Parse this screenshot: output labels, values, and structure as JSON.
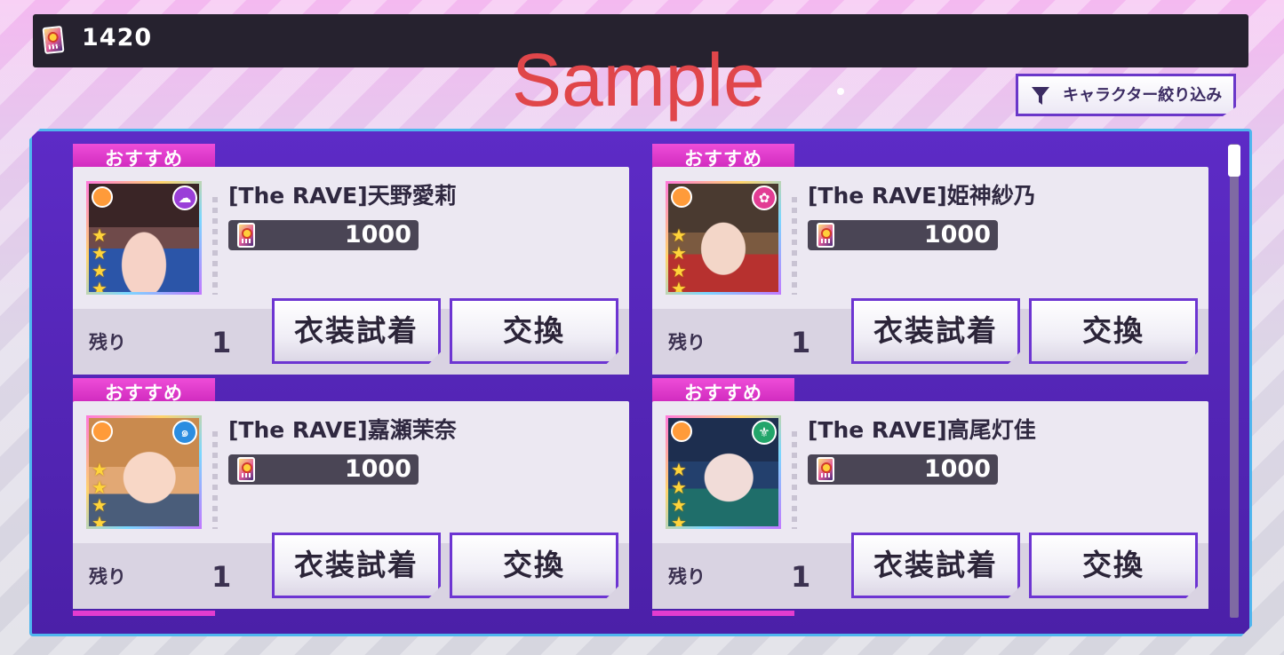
{
  "header": {
    "currency_amount": "1420",
    "currency_icon": "ticket-icon"
  },
  "watermark": "Sample",
  "filter": {
    "label": "キャラクター絞り込み",
    "icon": "filter-funnel-icon"
  },
  "labels": {
    "recommend": "おすすめ",
    "remaining": "残り",
    "try_on": "衣装試着",
    "exchange": "交換"
  },
  "cards": [
    {
      "name": "[The RAVE]天野愛莉",
      "price": "1000",
      "remaining": "1",
      "rarity": 4,
      "attribute_icon": "cute-attribute-icon",
      "attribute_color": "#9a3fd8"
    },
    {
      "name": "[The RAVE]姫神紗乃",
      "price": "1000",
      "remaining": "1",
      "rarity": 4,
      "attribute_icon": "ribbon-attribute-icon",
      "attribute_color": "#e23d94"
    },
    {
      "name": "[The RAVE]嘉瀬茉奈",
      "price": "1000",
      "remaining": "1",
      "rarity": 4,
      "attribute_icon": "swirl-attribute-icon",
      "attribute_color": "#2b8de0"
    },
    {
      "name": "[The RAVE]高尾灯佳",
      "price": "1000",
      "remaining": "1",
      "rarity": 4,
      "attribute_icon": "leaf-attribute-icon",
      "attribute_color": "#22a56a"
    }
  ],
  "colors": {
    "panel": "#5d2bc6",
    "panel_border": "#4fb6ee",
    "tab": "#e33ccf",
    "button_border": "#6d35d2"
  }
}
